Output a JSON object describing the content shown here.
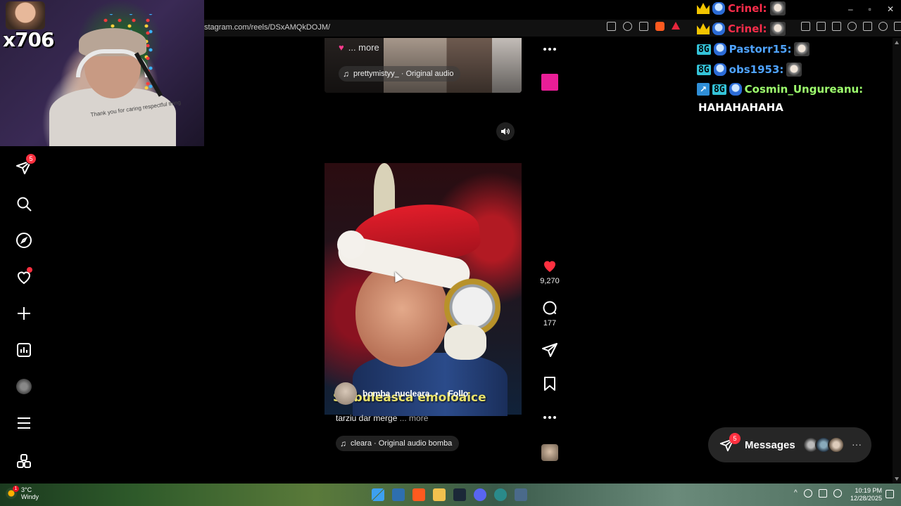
{
  "browser": {
    "url": "stagram.com/reels/DSxAMQkDOJM/"
  },
  "webcam": {
    "multiplier": "x706",
    "shirt_text": "Thank you for caring respectful thing"
  },
  "sidebar": {
    "items": [
      {
        "icon": "direct-messages-icon",
        "badge": "5"
      },
      {
        "icon": "search-icon"
      },
      {
        "icon": "explore-icon"
      },
      {
        "icon": "notifications-heart-icon",
        "dot": true
      },
      {
        "icon": "create-plus-icon"
      },
      {
        "icon": "dashboard-icon"
      },
      {
        "icon": "profile-avatar"
      },
      {
        "icon": "more-menu-icon"
      },
      {
        "icon": "also-from-meta-icon"
      }
    ]
  },
  "reel_top": {
    "more_label": "... more",
    "audio": "prettymistyy_ · Original audio"
  },
  "reel_main": {
    "overlay_caption": "Sa buleasca emoloaice",
    "author": "bomba_nucleara",
    "separator": "•",
    "follow_label": "Follo",
    "caption": "tarziu dar merge",
    "more_label": "... more",
    "audio": "cleara · Original audio  bomba"
  },
  "actions": {
    "likes": "9,270",
    "comments": "177"
  },
  "chat": {
    "lines": [
      {
        "name": "Crinel:"
      },
      {
        "name": "Crinel:"
      },
      {
        "tag": "8G",
        "name": "Pastorr15:"
      },
      {
        "tag": "8G",
        "name": "obs1953:"
      },
      {
        "tag": "8G",
        "name": "Cosmin_Ungureanu:",
        "message": "HAHAHAHAHA"
      }
    ]
  },
  "messages": {
    "label": "Messages",
    "badge": "5",
    "more": "···"
  },
  "taskbar": {
    "weather_badge": "1",
    "temperature": "3°C",
    "condition": "Windy",
    "time": "10:19 PM",
    "date": "12/28/2025"
  },
  "colors": {
    "background": "#000000",
    "notification_red": "#ff3040",
    "chat_red": "#ff2d4b",
    "chat_blue": "#4fa3ff",
    "chat_green": "#9eff6e",
    "crown_gold": "#f2c400",
    "pink_square": "#e91e97"
  }
}
